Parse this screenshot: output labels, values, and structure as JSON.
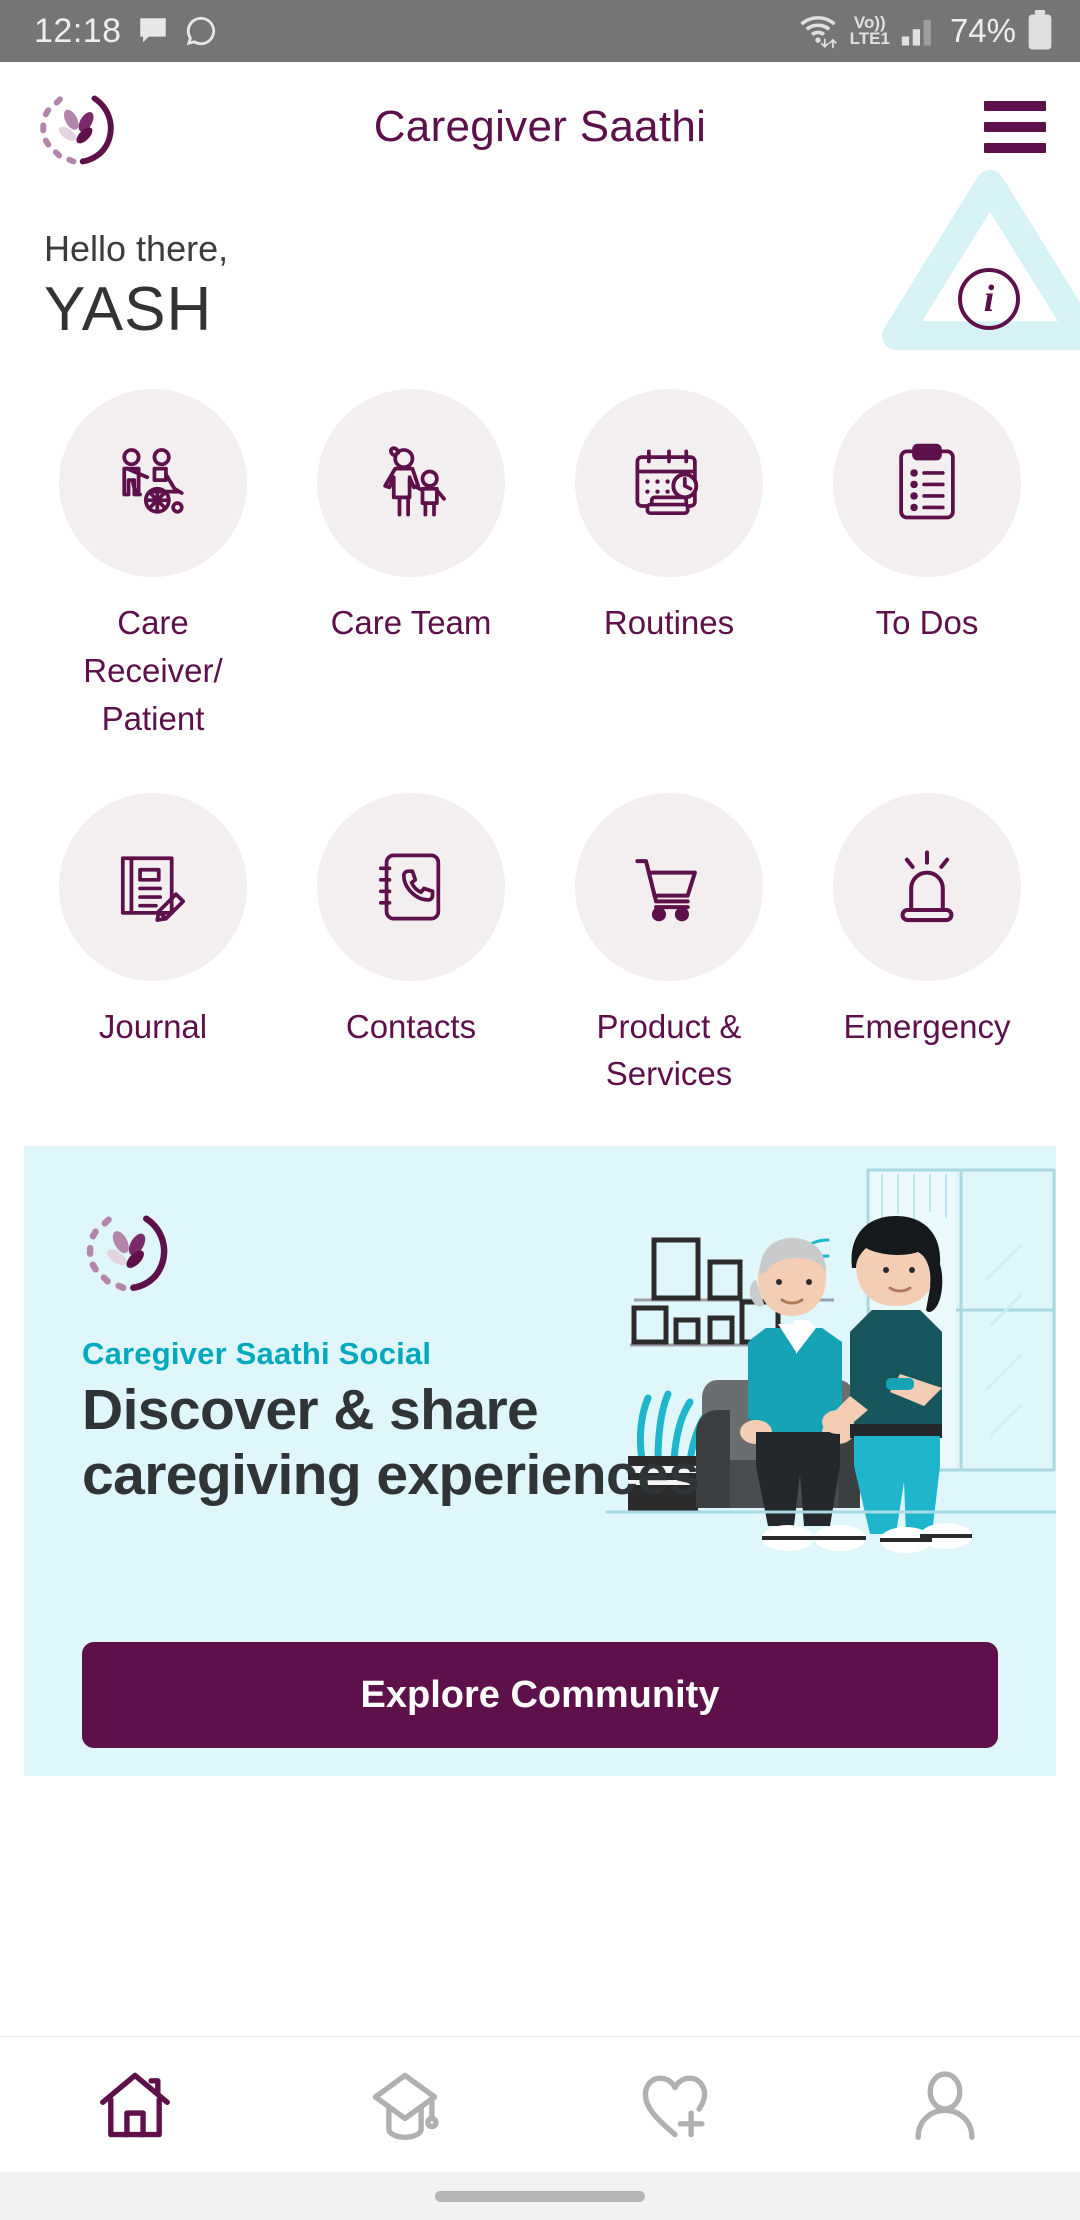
{
  "status_bar": {
    "time": "12:18",
    "icons_left": [
      "messages-icon",
      "whatsapp-icon"
    ],
    "wifi": "wifi-icon",
    "volte_top": "Vo))",
    "volte_bottom": "LTE1",
    "signal": "signal-bars-icon",
    "battery_percent": "74%",
    "battery": "battery-icon",
    "bg_color": "#757575"
  },
  "header": {
    "title": "Caregiver Saathi",
    "logo": "caregiver-saathi-logo",
    "menu": "hamburger-menu-icon",
    "title_color": "#5d1049"
  },
  "greeting": {
    "hello": "Hello there,",
    "name": "YASH",
    "info": "i",
    "info_icon": "info-icon",
    "decoration": "triangle-decoration"
  },
  "grid": {
    "row1": [
      {
        "label": "Care Receiver/ Patient",
        "icon": "wheelchair-caregiver-icon"
      },
      {
        "label": "Care Team",
        "icon": "family-icon"
      },
      {
        "label": "Routines",
        "icon": "calendar-clock-icon"
      },
      {
        "label": "To Dos",
        "icon": "clipboard-list-icon"
      }
    ],
    "row2": [
      {
        "label": "Journal",
        "icon": "notebook-pencil-icon"
      },
      {
        "label": "Contacts",
        "icon": "address-book-phone-icon"
      },
      {
        "label": "Product & Services",
        "icon": "shopping-cart-icon"
      },
      {
        "label": "Emergency",
        "icon": "siren-alarm-icon"
      }
    ],
    "circle_bg": "#f3eff1",
    "icon_color": "#5d1049"
  },
  "banner": {
    "logo": "caregiver-saathi-logo",
    "kicker": "Caregiver Saathi Social",
    "headline": "Discover & share caregiving experiences",
    "button_label": "Explore Community",
    "illustration": "caregiver-and-elderly-man-illustration",
    "bg_color": "#dff7fa",
    "kicker_color": "#00a9bd",
    "button_color": "#5d1049"
  },
  "bottom_nav": {
    "items": [
      {
        "name": "home",
        "icon": "home-icon",
        "active": true
      },
      {
        "name": "learn",
        "icon": "graduation-cap-icon",
        "active": false
      },
      {
        "name": "wellness",
        "icon": "heart-plus-icon",
        "active": false
      },
      {
        "name": "profile",
        "icon": "person-icon",
        "active": false
      }
    ],
    "active_color": "#5d1049",
    "inactive_color": "#b0b0b0"
  }
}
